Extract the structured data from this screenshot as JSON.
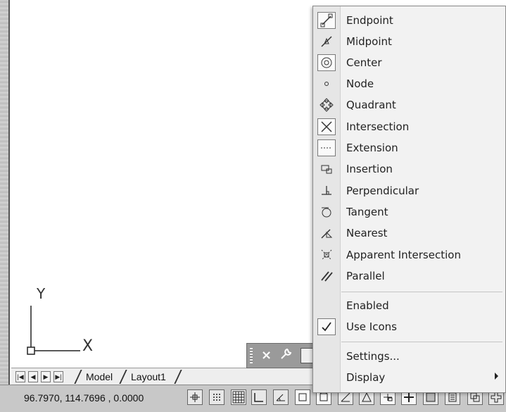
{
  "ucs": {
    "x_label": "X",
    "y_label": "Y"
  },
  "layout_tabs": {
    "nav": [
      "first",
      "previous",
      "next",
      "last"
    ],
    "tabs": [
      "Model",
      "Layout1"
    ]
  },
  "status_bar": {
    "coordinates": "96.7970,  114.7696 , 0.0000",
    "buttons": [
      "infer-constraints",
      "snap-mode",
      "grid-display",
      "ortho-mode",
      "polar-tracking",
      "object-snap",
      "3d-object-snap",
      "object-snap-tracking",
      "dynamic-ucs",
      "dynamic-input",
      "lineweight",
      "transparency",
      "quick-properties",
      "selection-cycling"
    ]
  },
  "context_menu": {
    "osnap_items": [
      {
        "label": "Endpoint",
        "icon": "endpoint-icon"
      },
      {
        "label": "Midpoint",
        "icon": "midpoint-icon"
      },
      {
        "label": "Center",
        "icon": "center-icon"
      },
      {
        "label": "Node",
        "icon": "node-icon"
      },
      {
        "label": "Quadrant",
        "icon": "quadrant-icon"
      },
      {
        "label": "Intersection",
        "icon": "intersection-icon"
      },
      {
        "label": "Extension",
        "icon": "extension-icon"
      },
      {
        "label": "Insertion",
        "icon": "insertion-icon"
      },
      {
        "label": "Perpendicular",
        "icon": "perpendicular-icon"
      },
      {
        "label": "Tangent",
        "icon": "tangent-icon"
      },
      {
        "label": "Nearest",
        "icon": "nearest-icon"
      },
      {
        "label": "Apparent Intersection",
        "icon": "apparent-intersection-icon"
      },
      {
        "label": "Parallel",
        "icon": "parallel-icon"
      }
    ],
    "enabled_label": "Enabled",
    "use_icons_label": "Use Icons",
    "use_icons_checked": true,
    "settings_label": "Settings...",
    "display_label": "Display"
  },
  "float_toolbar": {
    "close": "×",
    "options": "wrench"
  }
}
